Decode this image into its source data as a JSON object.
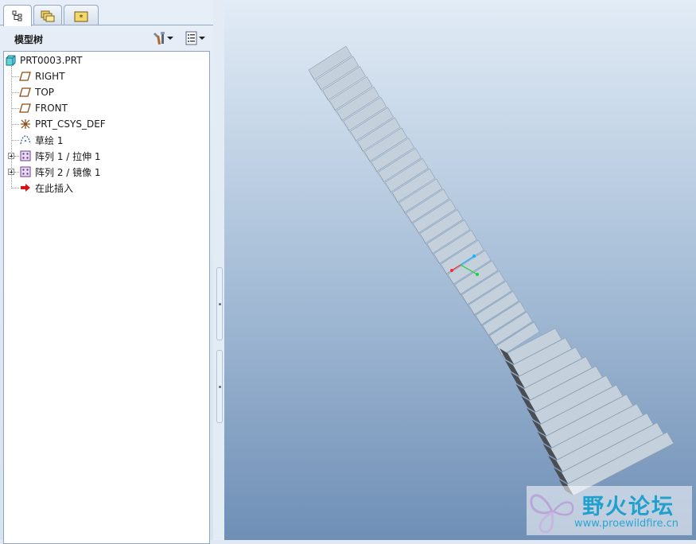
{
  "tabs": [
    {
      "icon": "model-tree-icon",
      "active": true
    },
    {
      "icon": "folder-browser-icon",
      "active": false
    },
    {
      "icon": "favorites-icon",
      "active": false
    }
  ],
  "model_tree": {
    "title": "模型树",
    "settings_icon": "tools-icon",
    "show_icon": "list-icon",
    "root": "PRT0003.PRT",
    "items": [
      {
        "label": "RIGHT",
        "icon": "datum-plane-icon"
      },
      {
        "label": "TOP",
        "icon": "datum-plane-icon"
      },
      {
        "label": "FRONT",
        "icon": "datum-plane-icon"
      },
      {
        "label": "PRT_CSYS_DEF",
        "icon": "coordinate-system-icon"
      },
      {
        "label": "草绘 1",
        "icon": "sketch-icon"
      },
      {
        "label": "阵列 1 / 拉伸 1",
        "icon": "pattern-icon",
        "expandable": true
      },
      {
        "label": "阵列 2 / 镜像 1",
        "icon": "pattern-icon",
        "expandable": true
      },
      {
        "label": "在此插入",
        "icon": "insert-here-arrow-icon"
      }
    ]
  },
  "watermark": {
    "title": "野火论坛",
    "url": "www.proewildfire.cn"
  },
  "colors": {
    "viewport_top": "#e2ecf6",
    "viewport_bottom": "#6f8fb6",
    "block_face": "#c4d0dc",
    "block_side": "#4a4e53",
    "accent_blue": "#1fa0cd"
  }
}
